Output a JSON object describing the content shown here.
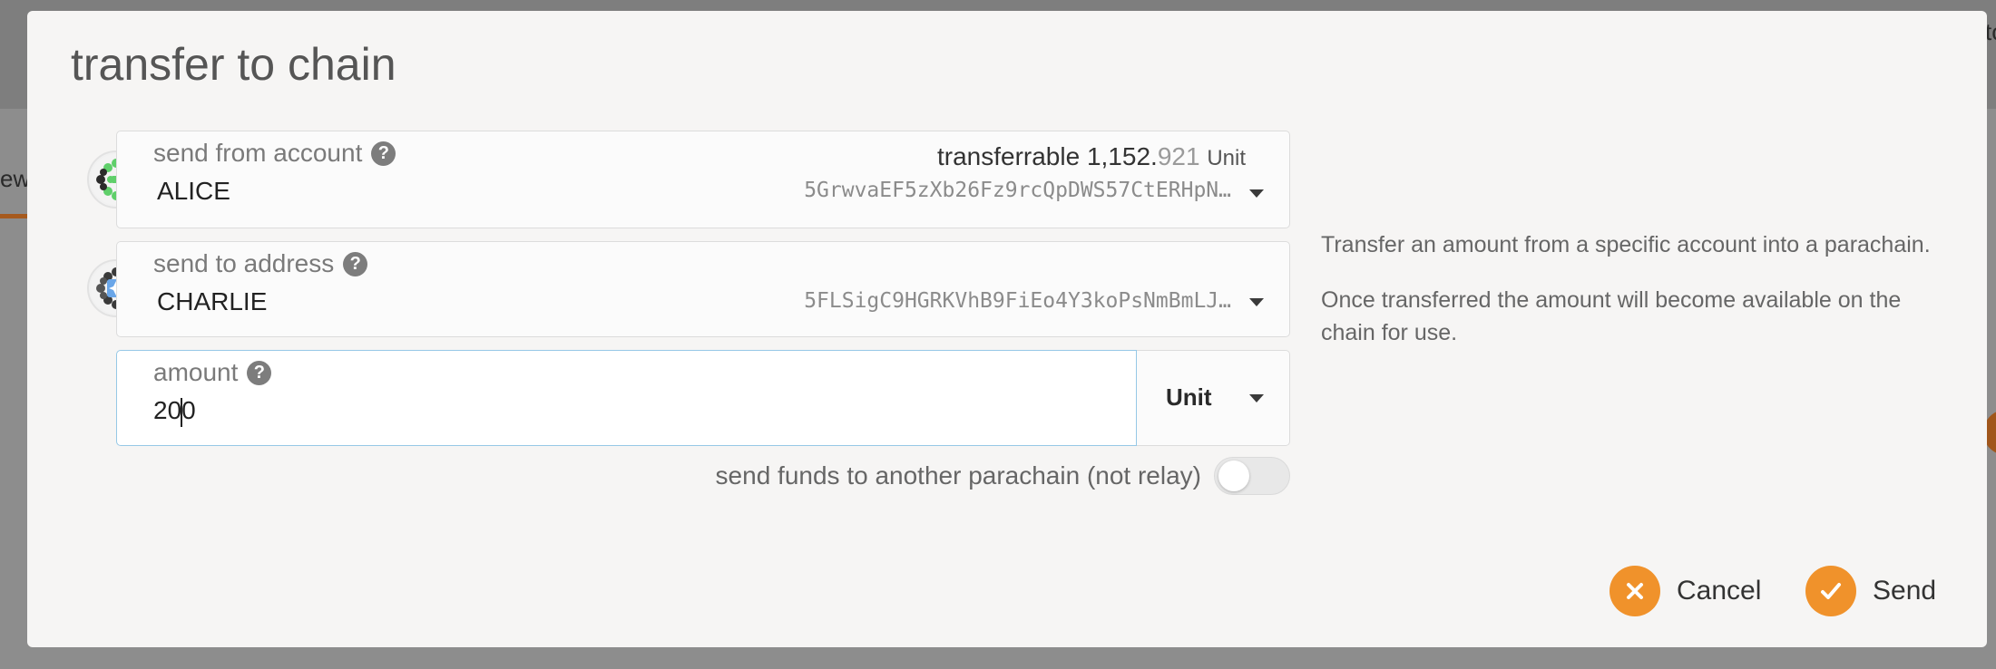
{
  "background": {
    "left_tab_fragment": "ew",
    "right_fragment": "to"
  },
  "modal": {
    "title": "transfer to chain"
  },
  "send_from": {
    "label": "send from account",
    "help_icon": "?",
    "transferrable_label": "transferrable",
    "transferrable_int": "1,152.",
    "transferrable_dec": "921",
    "transferrable_unit": "Unit",
    "account_name": "ALICE",
    "address": "5GrwvaEF5zXb26Fz9rcQpDWS57CtERHpN…",
    "avatar_icon": "identicon"
  },
  "send_to": {
    "label": "send to address",
    "help_icon": "?",
    "account_name": "CHARLIE",
    "address": "5FLSigC9HGRKVhB9FiEo4Y3koPsNmBmLJ…",
    "avatar_icon": "identicon"
  },
  "amount": {
    "label": "amount",
    "help_icon": "?",
    "value_before_cursor": "20",
    "value_after_cursor": "0",
    "unit": "Unit"
  },
  "parachain_toggle": {
    "label": "send funds to another parachain (not relay)",
    "enabled": false
  },
  "help": {
    "paragraph1": "Transfer an amount from a specific account into a parachain.",
    "paragraph2": "Once transferred the amount will become available on the chain for use."
  },
  "actions": {
    "cancel_label": "Cancel",
    "send_label": "Send"
  },
  "colors": {
    "accent": "#f0922b",
    "focus_border": "#96c8e6"
  }
}
